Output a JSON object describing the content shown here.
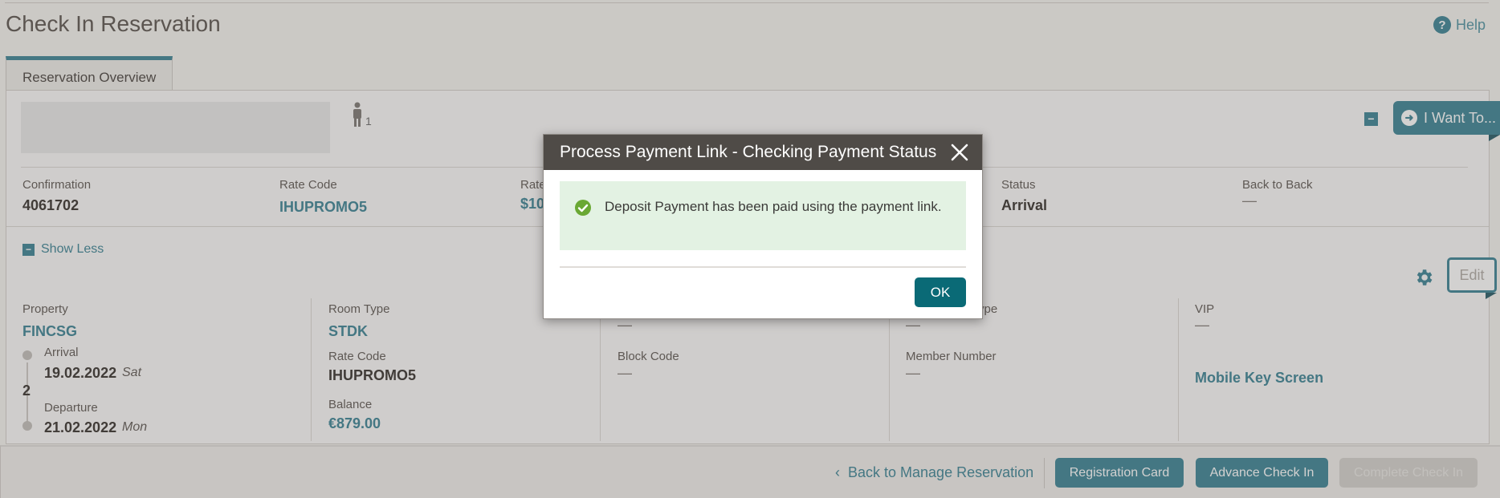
{
  "page": {
    "title": "Check In Reservation",
    "help_label": "Help"
  },
  "tabs": [
    {
      "label": "Reservation Overview"
    }
  ],
  "guest": {
    "adults": "1"
  },
  "actions": {
    "i_want_to": "I Want To..."
  },
  "summary": {
    "confirmation_label": "Confirmation",
    "confirmation_value": "4061702",
    "rate_code_label": "Rate Code",
    "rate_code_value": "IHUPROMO5",
    "rate_label": "Rate",
    "rate_value": "$10",
    "status_label": "Status",
    "status_value": "Arrival",
    "back_to_back_label": "Back to Back",
    "back_to_back_value": "—"
  },
  "details": {
    "show_less": "Show Less",
    "edit_label": "Edit",
    "property_label": "Property",
    "property_value": "FINCSG",
    "arrival_label": "Arrival",
    "arrival_date": "19.02.2022",
    "arrival_day": "Sat",
    "nights": "2",
    "departure_label": "Departure",
    "departure_date": "21.02.2022",
    "departure_day": "Mon",
    "room_type_label": "Room Type",
    "room_type_value": "STDK",
    "rate_code_label": "Rate Code",
    "rate_code_value": "IHUPROMO5",
    "balance_label": "Balance",
    "balance_value": "€879.00",
    "col3_dash": "—",
    "block_code_label": "Block Code",
    "block_code_value": "—",
    "col4_partial_label": "ype",
    "col4_dash": "—",
    "member_number_label": "Member Number",
    "member_number_value": "—",
    "vip_label": "VIP",
    "vip_value": "—",
    "mobile_key_link": "Mobile Key Screen"
  },
  "footer": {
    "back_link": "Back to Manage Reservation",
    "registration_card": "Registration Card",
    "advance_check_in": "Advance Check In",
    "complete_check_in": "Complete Check In"
  },
  "dialog": {
    "title": "Process Payment Link - Checking Payment Status",
    "message": "Deposit Payment has been paid using the payment link.",
    "ok_label": "OK"
  },
  "colors": {
    "accent": "#4e8f9f",
    "ok_button": "#0a6a76",
    "success_bg": "#e3f2e3",
    "check": "#6aa834",
    "header_bg": "#4f4b47"
  }
}
